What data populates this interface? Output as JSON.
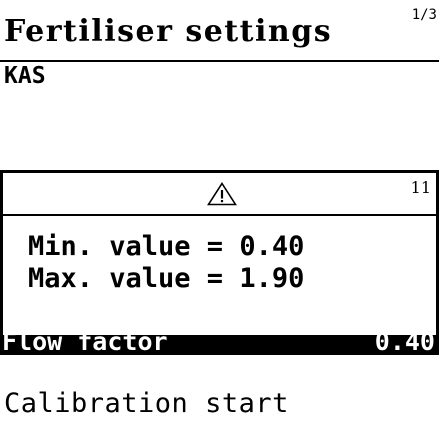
{
  "header": {
    "page_indicator": "1/3",
    "title": "Fertiliser settings"
  },
  "product": {
    "name": "KAS"
  },
  "warning_dialog": {
    "icon": "warning-triangle-icon",
    "number": "11",
    "min_line": "Min. value = 0.40",
    "max_line": "Max. value = 1.90"
  },
  "selected_row": {
    "label": "Flow factor",
    "value": "0.40"
  },
  "menu": {
    "calibration_start": "Calibration start"
  }
}
